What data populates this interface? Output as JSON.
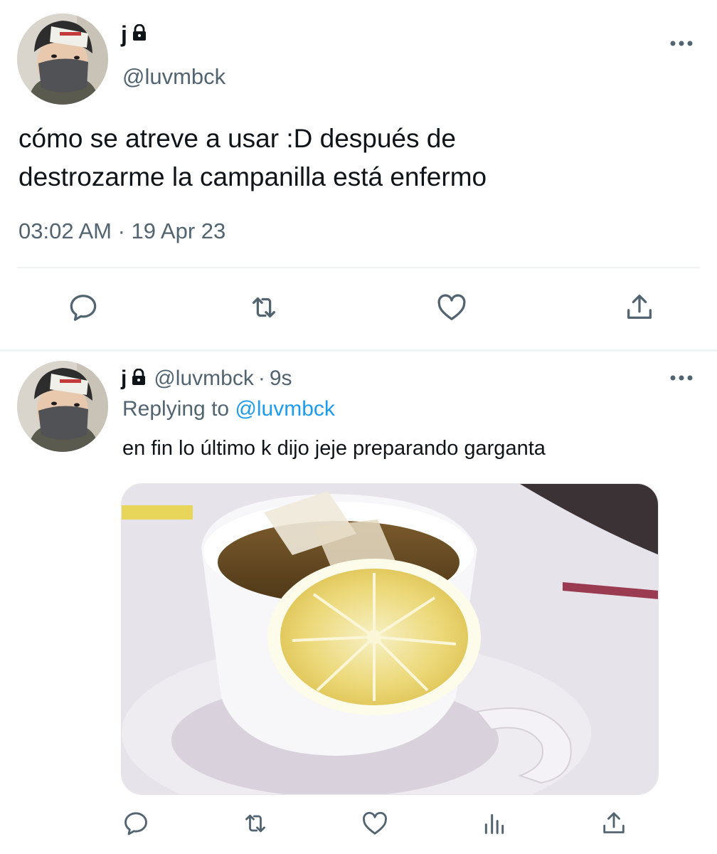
{
  "main_tweet": {
    "display_name": "j",
    "handle": "@luvmbck",
    "text_lines": [
      "cómo se atreve a usar :D después de",
      "destrozarme la campanilla está enfermo"
    ],
    "timestamp": "03:02 AM · 19 Apr 23",
    "icons": {
      "lock": "lock-icon",
      "more": "more-icon",
      "reply": "reply-icon",
      "retweet": "retweet-icon",
      "like": "heart-icon",
      "share": "share-icon"
    }
  },
  "reply_tweet": {
    "display_name": "j",
    "handle": "@luvmbck",
    "dot": "·",
    "time": "9s",
    "replying_prefix": "Replying to",
    "replying_to": "@luvmbck",
    "text": "en fin lo último k dijo jeje preparando garganta",
    "icons": {
      "reply": "reply-icon",
      "retweet": "retweet-icon",
      "like": "heart-icon",
      "analytics": "analytics-icon",
      "share": "share-icon"
    }
  },
  "colors": {
    "text_primary": "#0f1419",
    "text_secondary": "#536471",
    "link": "#1d9bf0",
    "divider": "#eff3f4"
  }
}
